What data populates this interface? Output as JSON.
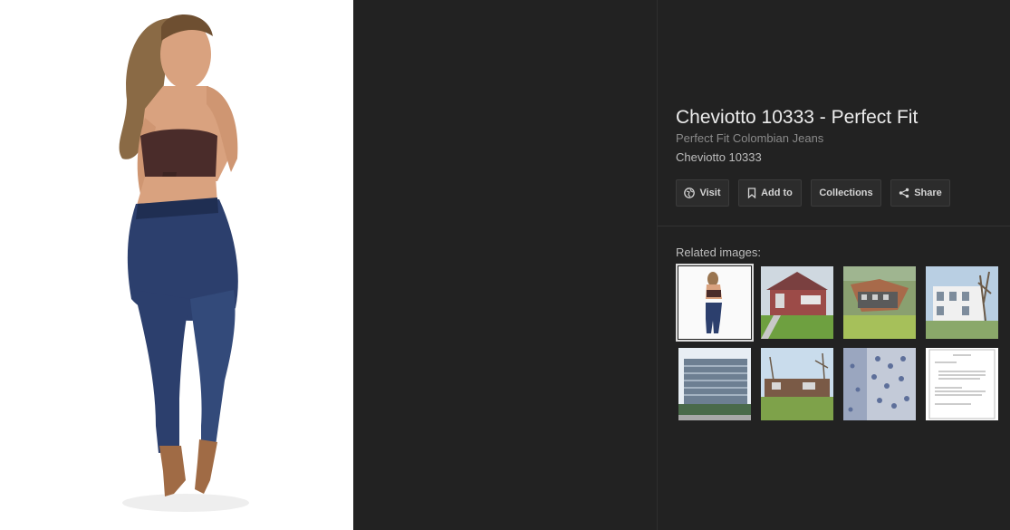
{
  "details": {
    "title": "Cheviotto 10333 - Perfect Fit",
    "source": "Perfect Fit Colombian Jeans",
    "description": "Cheviotto 10333"
  },
  "actions": {
    "visit": "Visit",
    "add_to": "Add to",
    "collections": "Collections",
    "share": "Share"
  },
  "related": {
    "label": "Related images:",
    "items": [
      {
        "name": "woman-in-jeans",
        "selected": true
      },
      {
        "name": "red-brick-house"
      },
      {
        "name": "apartment-building"
      },
      {
        "name": "townhouses"
      },
      {
        "name": "office-building"
      },
      {
        "name": "brick-ranch-house"
      },
      {
        "name": "blue-patterned-fabric"
      },
      {
        "name": "document-page"
      }
    ]
  },
  "colors": {
    "background": "#222222",
    "text_primary": "#ececec",
    "text_secondary": "#8a8a8a",
    "button_bg": "#2c2c2c"
  }
}
